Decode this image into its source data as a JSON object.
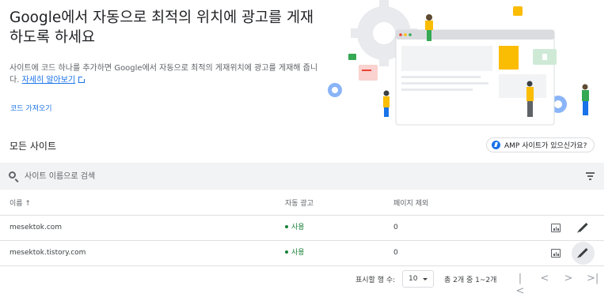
{
  "hero": {
    "title": "Google에서 자동으로 최적의 위치에 광고를 게재하도록 하세요",
    "description": "사이트에 코드 하나를 추가하면 Google에서 자동으로 최적의 게재위치에 광고를 게재해 줍니다.",
    "learn_more": "자세히 알아보기",
    "get_code": "코드 가져오기"
  },
  "section": {
    "title": "모든 사이트",
    "amp_button": "AMP 사이트가 있으신가요?"
  },
  "search": {
    "placeholder": "사이트 이름으로 검색"
  },
  "table": {
    "columns": [
      "이름 ↑",
      "자동 광고",
      "페이지 제외"
    ],
    "rows": [
      {
        "name": "mesektok.com",
        "status": "사용",
        "excluded": "0"
      },
      {
        "name": "mesektok.tistory.com",
        "status": "사용",
        "excluded": "0"
      }
    ]
  },
  "pagination": {
    "rows_label": "표시할 행 수:",
    "rows_value": "10",
    "range": "총 2개 중 1~2개",
    "first": "|<",
    "prev": "<",
    "next": ">",
    "last": ">|"
  },
  "colors": {
    "primary_blue": "#1a73e8",
    "status_green": "#188038",
    "search_bg": "#f1f3f4"
  }
}
